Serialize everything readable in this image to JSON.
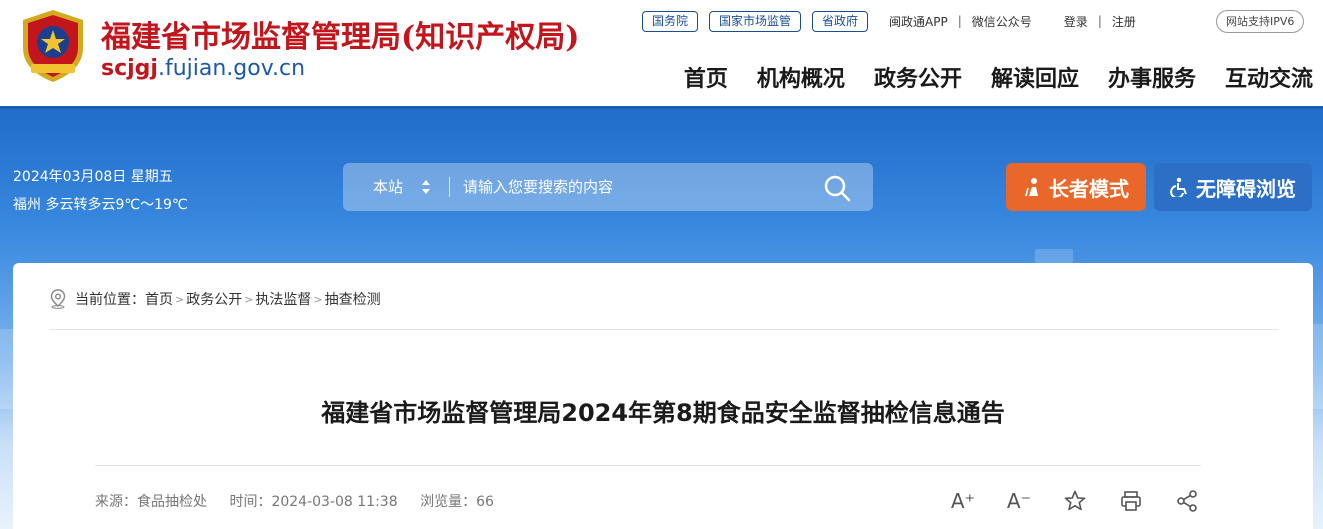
{
  "header": {
    "title": "福建省市场监督管理局(知识产权局)",
    "domain_highlight": "scjgj",
    "domain_rest": ".fujian.gov.cn",
    "toplinks": {
      "gov1": "国务院",
      "gov2": "国家市场监管",
      "gov3": "省政府",
      "app": "闽政通APP",
      "wechat": "微信公众号",
      "login": "登录",
      "register": "注册",
      "ipv6": "网站支持IPV6",
      "separator": "|"
    },
    "nav": [
      "首页",
      "机构概况",
      "政务公开",
      "解读回应",
      "办事服务",
      "互动交流"
    ]
  },
  "banner": {
    "date": "2024年03月08日 星期五",
    "weather": "福州 多云转多云9℃～19℃",
    "search": {
      "scope": "本站",
      "placeholder": "请输入您要搜索的内容",
      "icon": "search-icon"
    },
    "elder_mode": "长者模式",
    "accessibility": "无障碍浏览"
  },
  "breadcrumb": {
    "prefix": "当前位置：",
    "items": [
      "首页",
      "政务公开",
      "执法监督",
      "抽查检测"
    ],
    "arrow": ">"
  },
  "article": {
    "title": "福建省市场监督管理局2024年第8期食品安全监督抽检信息通告",
    "source": "来源：食品抽检处",
    "time": "时间：2024-03-08 11:38",
    "views": "浏览量：66",
    "tools": {
      "font_up": "A⁺",
      "font_down": "A⁻"
    }
  },
  "colors": {
    "brand_red": "#c3161c",
    "brand_blue": "#1a5fb4",
    "elder_orange": "#e9672a"
  }
}
